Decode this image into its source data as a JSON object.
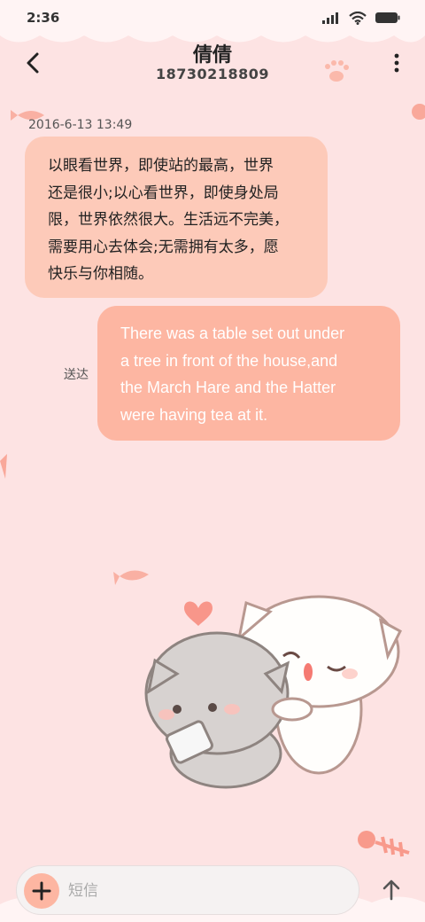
{
  "status_bar": {
    "time": "2:36"
  },
  "header": {
    "name": "倩倩",
    "number": "18730218809"
  },
  "conversation": {
    "timestamp": "2016-6-13 13:49",
    "incoming": {
      "lines": [
        "以眼看世界，即使站的最高，世界",
        "还是很小;以心看世界，即使身处局",
        "限，世界依然很大。生活远不完美，",
        "需要用心去体会;无需拥有太多，愿",
        "快乐与你相随。"
      ]
    },
    "outgoing": {
      "lines": [
        "There was a table set out under",
        "a tree in front of the house,and",
        "the March Hare and the Hatter",
        "were having tea at it."
      ],
      "status": "送达"
    }
  },
  "composer": {
    "placeholder": "短信"
  },
  "icons": {
    "back": "chevron-left-icon",
    "more": "more-vertical-icon",
    "attach": "plus-icon",
    "send": "arrow-up-icon"
  },
  "colors": {
    "background": "#fde3e3",
    "incoming_bubble": "#fdcab9",
    "outgoing_bubble": "#fdb6a2",
    "outgoing_text": "#ffffff"
  }
}
